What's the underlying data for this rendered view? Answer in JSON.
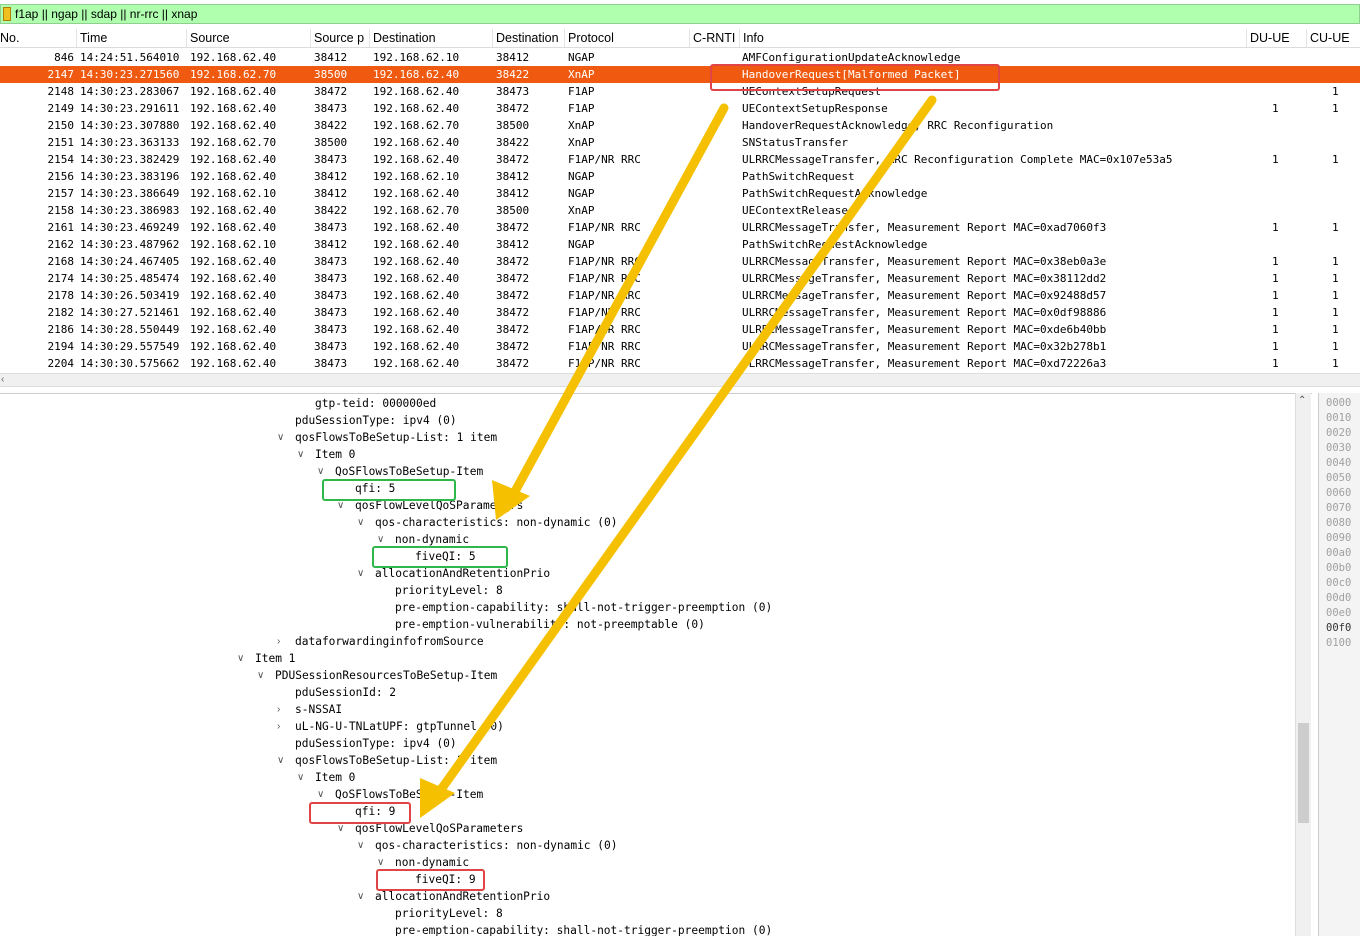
{
  "filter": {
    "value": "f1ap || ngap || sdap || nr-rrc || xnap"
  },
  "columns": [
    "No.",
    "Time",
    "Source",
    "Source p",
    "Destination",
    "Destination",
    "Protocol",
    "C-RNTI",
    "Info",
    "DU-UE",
    "CU-UE"
  ],
  "packets": [
    {
      "no": "846",
      "time": "14:24:51.564010",
      "src": "192.168.62.40",
      "sport": "38412",
      "dst": "192.168.62.10",
      "dport": "38412",
      "proto": "NGAP",
      "info": "AMFConfigurationUpdateAcknowledge",
      "du": "",
      "cu": ""
    },
    {
      "no": "2147",
      "time": "14:30:23.271560",
      "src": "192.168.62.70",
      "sport": "38500",
      "dst": "192.168.62.40",
      "dport": "38422",
      "proto": "XnAP",
      "info": "HandoverRequest[Malformed Packet]",
      "du": "",
      "cu": ""
    },
    {
      "no": "2148",
      "time": "14:30:23.283067",
      "src": "192.168.62.40",
      "sport": "38472",
      "dst": "192.168.62.40",
      "dport": "38473",
      "proto": "F1AP",
      "info": "UEContextSetupRequest",
      "du": "",
      "cu": "1"
    },
    {
      "no": "2149",
      "time": "14:30:23.291611",
      "src": "192.168.62.40",
      "sport": "38473",
      "dst": "192.168.62.40",
      "dport": "38472",
      "proto": "F1AP",
      "info": "UEContextSetupResponse",
      "du": "1",
      "cu": "1"
    },
    {
      "no": "2150",
      "time": "14:30:23.307880",
      "src": "192.168.62.40",
      "sport": "38422",
      "dst": "192.168.62.70",
      "dport": "38500",
      "proto": "XnAP",
      "info": "HandoverRequestAcknowledge, RRC Reconfiguration",
      "du": "",
      "cu": ""
    },
    {
      "no": "2151",
      "time": "14:30:23.363133",
      "src": "192.168.62.70",
      "sport": "38500",
      "dst": "192.168.62.40",
      "dport": "38422",
      "proto": "XnAP",
      "info": "SNStatusTransfer",
      "du": "",
      "cu": ""
    },
    {
      "no": "2154",
      "time": "14:30:23.382429",
      "src": "192.168.62.40",
      "sport": "38473",
      "dst": "192.168.62.40",
      "dport": "38472",
      "proto": "F1AP/NR RRC",
      "info": "ULRRCMessageTransfer, RRC Reconfiguration Complete MAC=0x107e53a5",
      "du": "1",
      "cu": "1"
    },
    {
      "no": "2156",
      "time": "14:30:23.383196",
      "src": "192.168.62.40",
      "sport": "38412",
      "dst": "192.168.62.10",
      "dport": "38412",
      "proto": "NGAP",
      "info": "PathSwitchRequest",
      "du": "",
      "cu": ""
    },
    {
      "no": "2157",
      "time": "14:30:23.386649",
      "src": "192.168.62.10",
      "sport": "38412",
      "dst": "192.168.62.40",
      "dport": "38412",
      "proto": "NGAP",
      "info": "PathSwitchRequestAcknowledge",
      "du": "",
      "cu": ""
    },
    {
      "no": "2158",
      "time": "14:30:23.386983",
      "src": "192.168.62.40",
      "sport": "38422",
      "dst": "192.168.62.70",
      "dport": "38500",
      "proto": "XnAP",
      "info": "UEContextRelease",
      "du": "",
      "cu": ""
    },
    {
      "no": "2161",
      "time": "14:30:23.469249",
      "src": "192.168.62.40",
      "sport": "38473",
      "dst": "192.168.62.40",
      "dport": "38472",
      "proto": "F1AP/NR RRC",
      "info": "ULRRCMessageTransfer, Measurement Report MAC=0xad7060f3",
      "du": "1",
      "cu": "1"
    },
    {
      "no": "2162",
      "time": "14:30:23.487962",
      "src": "192.168.62.10",
      "sport": "38412",
      "dst": "192.168.62.40",
      "dport": "38412",
      "proto": "NGAP",
      "info": "PathSwitchRequestAcknowledge",
      "du": "",
      "cu": ""
    },
    {
      "no": "2168",
      "time": "14:30:24.467405",
      "src": "192.168.62.40",
      "sport": "38473",
      "dst": "192.168.62.40",
      "dport": "38472",
      "proto": "F1AP/NR RRC",
      "info": "ULRRCMessageTransfer, Measurement Report MAC=0x38eb0a3e",
      "du": "1",
      "cu": "1"
    },
    {
      "no": "2174",
      "time": "14:30:25.485474",
      "src": "192.168.62.40",
      "sport": "38473",
      "dst": "192.168.62.40",
      "dport": "38472",
      "proto": "F1AP/NR RRC",
      "info": "ULRRCMessageTransfer, Measurement Report MAC=0x38112dd2",
      "du": "1",
      "cu": "1"
    },
    {
      "no": "2178",
      "time": "14:30:26.503419",
      "src": "192.168.62.40",
      "sport": "38473",
      "dst": "192.168.62.40",
      "dport": "38472",
      "proto": "F1AP/NR RRC",
      "info": "ULRRCMessageTransfer, Measurement Report MAC=0x92488d57",
      "du": "1",
      "cu": "1"
    },
    {
      "no": "2182",
      "time": "14:30:27.521461",
      "src": "192.168.62.40",
      "sport": "38473",
      "dst": "192.168.62.40",
      "dport": "38472",
      "proto": "F1AP/NR RRC",
      "info": "ULRRCMessageTransfer, Measurement Report MAC=0x0df98886",
      "du": "1",
      "cu": "1"
    },
    {
      "no": "2186",
      "time": "14:30:28.550449",
      "src": "192.168.62.40",
      "sport": "38473",
      "dst": "192.168.62.40",
      "dport": "38472",
      "proto": "F1AP/NR RRC",
      "info": "ULRRCMessageTransfer, Measurement Report MAC=0xde6b40bb",
      "du": "1",
      "cu": "1"
    },
    {
      "no": "2194",
      "time": "14:30:29.557549",
      "src": "192.168.62.40",
      "sport": "38473",
      "dst": "192.168.62.40",
      "dport": "38472",
      "proto": "F1AP/NR RRC",
      "info": "ULRRCMessageTransfer, Measurement Report MAC=0x32b278b1",
      "du": "1",
      "cu": "1"
    },
    {
      "no": "2204",
      "time": "14:30:30.575662",
      "src": "192.168.62.40",
      "sport": "38473",
      "dst": "192.168.62.40",
      "dport": "38472",
      "proto": "F1AP/NR RRC",
      "info": "ULRRCMessageTransfer, Measurement Report MAC=0xd72226a3",
      "du": "1",
      "cu": "1"
    }
  ],
  "selected_index": 1,
  "tree": [
    {
      "lvl": 2,
      "tw": "",
      "text": "gtp-teid: 000000ed"
    },
    {
      "lvl": 1,
      "tw": "",
      "text": "pduSessionType: ipv4 (0)"
    },
    {
      "lvl": 1,
      "tw": "down",
      "text": "qosFlowsToBeSetup-List: 1 item"
    },
    {
      "lvl": 2,
      "tw": "down",
      "text": "Item 0"
    },
    {
      "lvl": 3,
      "tw": "down",
      "text": "QoSFlowsToBeSetup-Item"
    },
    {
      "lvl": 4,
      "tw": "",
      "text": "qfi: 5"
    },
    {
      "lvl": 4,
      "tw": "down",
      "text": "qosFlowLevelQoSParameters"
    },
    {
      "lvl": 5,
      "tw": "down",
      "text": "qos-characteristics: non-dynamic (0)"
    },
    {
      "lvl": 6,
      "tw": "down",
      "text": "non-dynamic"
    },
    {
      "lvl": 7,
      "tw": "",
      "text": "fiveQI: 5"
    },
    {
      "lvl": 5,
      "tw": "down",
      "text": "allocationAndRetentionPrio"
    },
    {
      "lvl": 6,
      "tw": "",
      "text": "priorityLevel: 8"
    },
    {
      "lvl": 6,
      "tw": "",
      "text": "pre-emption-capability: shall-not-trigger-preemption (0)"
    },
    {
      "lvl": 6,
      "tw": "",
      "text": "pre-emption-vulnerability: not-preemptable (0)"
    },
    {
      "lvl": 1,
      "tw": "right",
      "text": "dataforwardinginfofromSource"
    },
    {
      "lvl": -1,
      "tw": "down",
      "text": "Item 1"
    },
    {
      "lvl": 0,
      "tw": "down",
      "text": "PDUSessionResourcesToBeSetup-Item"
    },
    {
      "lvl": 1,
      "tw": "",
      "text": "pduSessionId: 2"
    },
    {
      "lvl": 1,
      "tw": "right",
      "text": "s-NSSAI"
    },
    {
      "lvl": 1,
      "tw": "right",
      "text": "uL-NG-U-TNLatUPF: gtpTunnel (0)"
    },
    {
      "lvl": 1,
      "tw": "",
      "text": "pduSessionType: ipv4 (0)"
    },
    {
      "lvl": 1,
      "tw": "down",
      "text": "qosFlowsToBeSetup-List: 1 item"
    },
    {
      "lvl": 2,
      "tw": "down",
      "text": "Item 0"
    },
    {
      "lvl": 3,
      "tw": "down",
      "text": "QoSFlowsToBeSetup-Item"
    },
    {
      "lvl": 4,
      "tw": "",
      "text": "qfi: 9"
    },
    {
      "lvl": 4,
      "tw": "down",
      "text": "qosFlowLevelQoSParameters"
    },
    {
      "lvl": 5,
      "tw": "down",
      "text": "qos-characteristics: non-dynamic (0)"
    },
    {
      "lvl": 6,
      "tw": "down",
      "text": "non-dynamic"
    },
    {
      "lvl": 7,
      "tw": "",
      "text": "fiveQI: 9"
    },
    {
      "lvl": 5,
      "tw": "down",
      "text": "allocationAndRetentionPrio"
    },
    {
      "lvl": 6,
      "tw": "",
      "text": "priorityLevel: 8"
    },
    {
      "lvl": 6,
      "tw": "",
      "text": "pre-emption-capability: shall-not-trigger-preemption (0)"
    }
  ],
  "hex_offsets": [
    "0000",
    "0010",
    "0020",
    "0030",
    "0040",
    "0050",
    "0060",
    "0070",
    "0080",
    "0090",
    "00a0",
    "00b0",
    "00c0",
    "00d0",
    "00e0",
    "00f0",
    "0100"
  ],
  "hex_active": "00f0",
  "annotation_colors": {
    "red": "#e04444",
    "green": "#2eb84a",
    "arrow": "#f5c000",
    "selected_row": "#f05a10",
    "filter_bg": "#afffaf"
  }
}
